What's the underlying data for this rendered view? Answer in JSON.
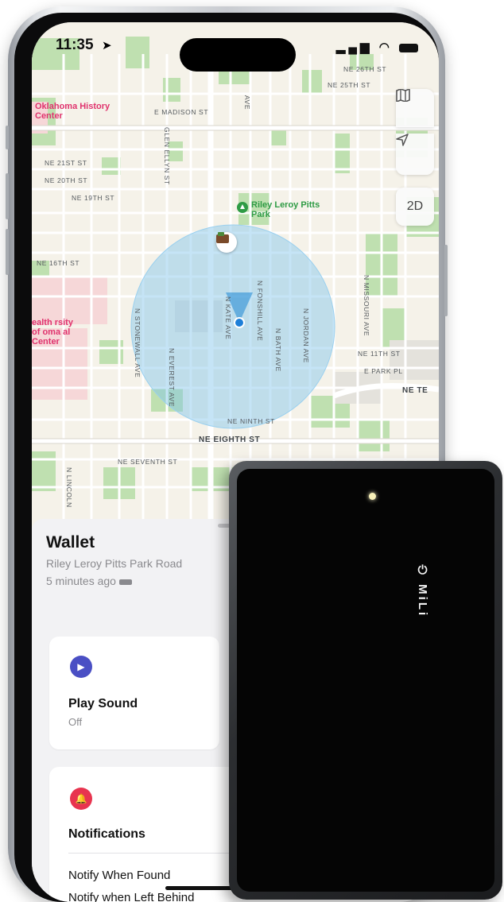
{
  "status_bar": {
    "time": "11:35"
  },
  "map": {
    "controls": {
      "view_mode": "2D"
    },
    "pois": [
      {
        "label": "Oklahoma History Center"
      },
      {
        "label": "Riley Leroy Pitts Park"
      },
      {
        "label": "ealth rsity of oma al Center"
      }
    ],
    "streets": {
      "ne_madison": "E MADISON ST",
      "ne_25th": "NE 25TH ST",
      "ne_26th": "NE 26TH ST",
      "ne_21st": "NE 21ST ST",
      "ne_20th": "NE 20TH ST",
      "ne_19th": "NE 19TH ST",
      "ne_16th": "NE 16TH ST",
      "ne_11th": "NE 11TH ST",
      "e_park": "E PARK PL",
      "ne_te": "NE TE",
      "ne_ninth": "NE NINTH ST",
      "ne_eighth": "NE EIGHTH ST",
      "ne_seventh": "NE SEVENTH ST",
      "glen_ellyn": "GLEN ELLYN ST",
      "n_foshill": "N FONSHILL AVE",
      "n_bath": "N BATH AVE",
      "n_jordan": "N JORDAN AVE",
      "n_missouri": "N MISSOURI AVE",
      "n_kate": "N KATE AVE",
      "n_everest": "N EVEREST AVE",
      "n_stonewall": "N STONEWALL AVE",
      "n_lincoln": "N LINCOLN",
      "ave": "AVE"
    }
  },
  "sheet": {
    "title": "Wallet",
    "location": "Riley Leroy Pitts Park Road",
    "updated": "5 minutes ago",
    "cards": [
      {
        "label": "Play Sound",
        "sub": "Off",
        "icon_color": "#4a4fc4"
      },
      {
        "label": "Notifications",
        "sub": "",
        "icon_color": "#e8344f"
      }
    ],
    "notify_row": "Notify When Found",
    "notify_row_cut": "Notify when Left Behind"
  },
  "tracker": {
    "brand": "MiLi"
  }
}
